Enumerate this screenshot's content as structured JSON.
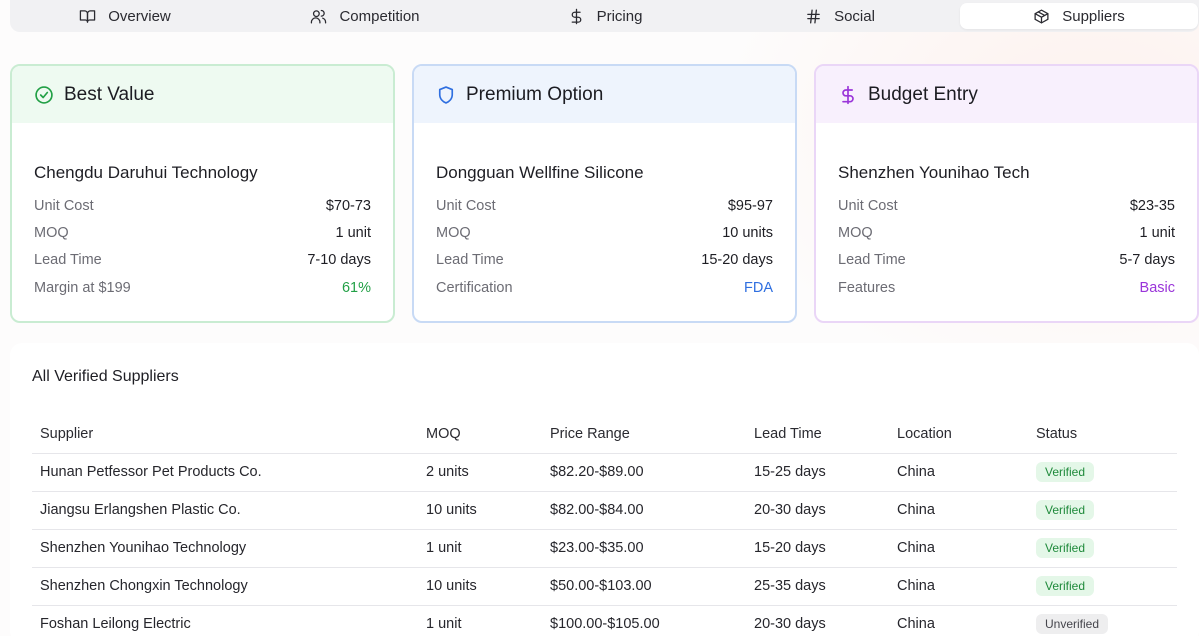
{
  "tabs": [
    {
      "label": "Overview",
      "icon": "book-open-icon"
    },
    {
      "label": "Competition",
      "icon": "users-icon"
    },
    {
      "label": "Pricing",
      "icon": "dollar-icon"
    },
    {
      "label": "Social",
      "icon": "hash-icon"
    },
    {
      "label": "Suppliers",
      "icon": "package-icon",
      "active": true
    }
  ],
  "cards": [
    {
      "title": "Best Value",
      "icon": "check-circle-icon",
      "accent": "#22a046",
      "supplier": "Chengdu Daruhui Technology",
      "rows": [
        {
          "label": "Unit Cost",
          "value": "$70-73"
        },
        {
          "label": "MOQ",
          "value": "1 unit"
        },
        {
          "label": "Lead Time",
          "value": "7-10 days"
        },
        {
          "label": "Margin at $199",
          "value": "61%"
        }
      ]
    },
    {
      "title": "Premium Option",
      "icon": "shield-icon",
      "accent": "#2f6fe0",
      "supplier": "Dongguan Wellfine Silicone",
      "rows": [
        {
          "label": "Unit Cost",
          "value": "$95-97"
        },
        {
          "label": "MOQ",
          "value": "10 units"
        },
        {
          "label": "Lead Time",
          "value": "15-20 days"
        },
        {
          "label": "Certification",
          "value": "FDA"
        }
      ]
    },
    {
      "title": "Budget Entry",
      "icon": "dollar-icon",
      "accent": "#9a35d9",
      "supplier": "Shenzhen Younihao Tech",
      "rows": [
        {
          "label": "Unit Cost",
          "value": "$23-35"
        },
        {
          "label": "MOQ",
          "value": "1 unit"
        },
        {
          "label": "Lead Time",
          "value": "5-7 days"
        },
        {
          "label": "Features",
          "value": "Basic"
        }
      ]
    }
  ],
  "table": {
    "title": "All Verified Suppliers",
    "columns": [
      "Supplier",
      "MOQ",
      "Price Range",
      "Lead Time",
      "Location",
      "Status"
    ],
    "rows": [
      [
        "Hunan Petfessor Pet Products Co.",
        "2 units",
        "$82.20-$89.00",
        "15-25 days",
        "China",
        "Verified"
      ],
      [
        "Jiangsu Erlangshen Plastic Co.",
        "10 units",
        "$82.00-$84.00",
        "20-30 days",
        "China",
        "Verified"
      ],
      [
        "Shenzhen Younihao Technology",
        "1 unit",
        "$23.00-$35.00",
        "15-20 days",
        "China",
        "Verified"
      ],
      [
        "Shenzhen Chongxin Technology",
        "10 units",
        "$50.00-$103.00",
        "25-35 days",
        "China",
        "Verified"
      ],
      [
        "Foshan Leilong Electric",
        "1 unit",
        "$100.00-$105.00",
        "20-30 days",
        "China",
        "Unverified"
      ]
    ]
  }
}
